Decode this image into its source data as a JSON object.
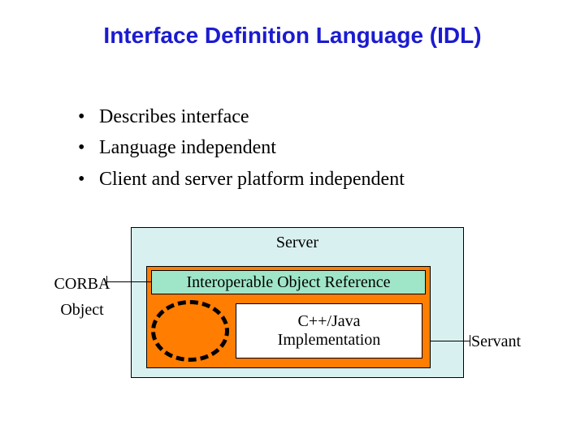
{
  "title": "Interface Definition Language (IDL)",
  "bullets": [
    "Describes interface",
    "Language independent",
    "Client and server platform independent"
  ],
  "diagram": {
    "server_label": "Server",
    "ior_label": "Interoperable Object Reference",
    "impl_label_line1": "C++/Java",
    "impl_label_line2": "Implementation",
    "corba_line1": "CORBA",
    "corba_line2": "Object",
    "servant_label": "Servant"
  },
  "colors": {
    "title": "#1b1bd0",
    "server_bg": "#d9f0f0",
    "orange_bg": "#ff7d00",
    "ior_bg": "#9fe6c8"
  }
}
